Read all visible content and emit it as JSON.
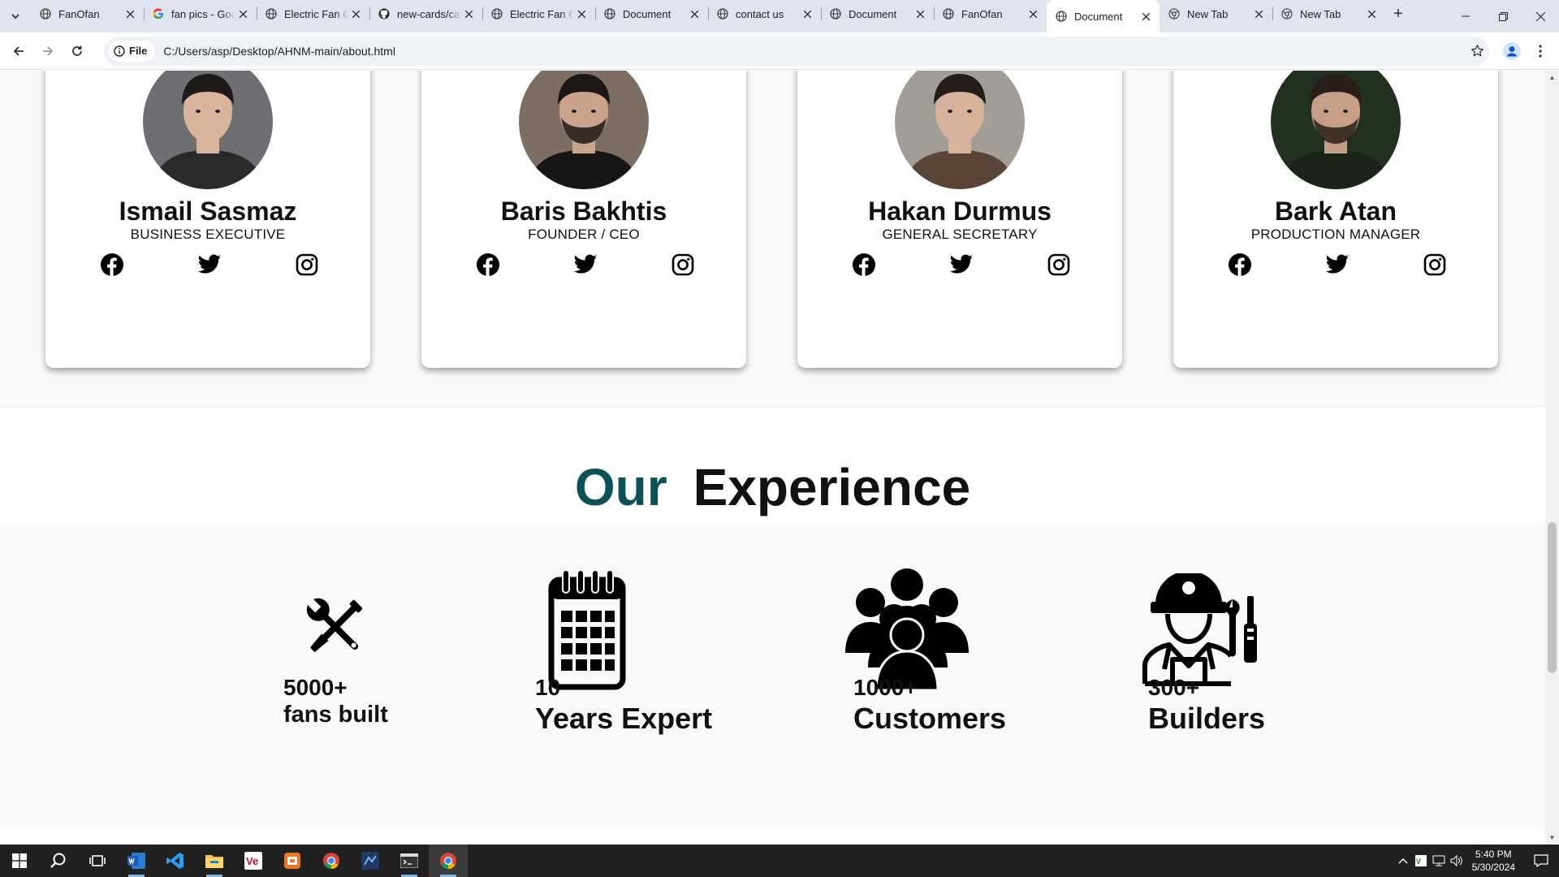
{
  "browser": {
    "tabs": [
      {
        "title": "FanOfan",
        "favicon": "globe-icon"
      },
      {
        "title": "fan pics - Google Search",
        "favicon": "google-icon"
      },
      {
        "title": "Electric Fan Company",
        "favicon": "globe-icon"
      },
      {
        "title": "new-cards/cards",
        "favicon": "github-icon"
      },
      {
        "title": "Electric Fan Company",
        "favicon": "globe-icon"
      },
      {
        "title": "Document",
        "favicon": "globe-icon"
      },
      {
        "title": "contact us",
        "favicon": "globe-icon"
      },
      {
        "title": "Document",
        "favicon": "globe-icon"
      },
      {
        "title": "FanOfan",
        "favicon": "globe-icon"
      },
      {
        "title": "Document",
        "favicon": "globe-icon",
        "active": true
      },
      {
        "title": "New Tab",
        "favicon": "chrome-icon"
      },
      {
        "title": "New Tab",
        "favicon": "chrome-icon"
      }
    ],
    "site_chip": "File",
    "url": "C:/Users/asp/Desktop/AHNM-main/about.html"
  },
  "team": {
    "members": [
      {
        "name": "Ismail Sasmaz",
        "role": "BUSINESS EXECUTIVE"
      },
      {
        "name": "Baris Bakhtis",
        "role": "FOUNDER / CEO"
      },
      {
        "name": "Hakan Durmus",
        "role": "GENERAL SECRETARY"
      },
      {
        "name": "Bark Atan",
        "role": "PRODUCTION MANAGER"
      }
    ],
    "social_icons": [
      "facebook-icon",
      "twitter-icon",
      "instagram-icon"
    ]
  },
  "experience": {
    "title_accent": "Our",
    "title_rest": "Experience",
    "accent_color": "#0b5158",
    "stats": [
      {
        "number": "5000+",
        "label": "fans built",
        "icon": "tools-icon"
      },
      {
        "number": "10",
        "label": "Years Expert",
        "icon": "calendar-icon"
      },
      {
        "number": "1000+",
        "label": "Customers",
        "icon": "users-icon"
      },
      {
        "number": "300+",
        "label": "Builders",
        "icon": "worker-icon"
      }
    ]
  },
  "taskbar": {
    "apps": [
      "start-icon",
      "search-icon",
      "task-view-icon",
      "word-icon",
      "vscode-icon",
      "file-explorer-icon",
      "app-ve-icon",
      "app-orange-icon",
      "chrome-icon",
      "app-blue-icon",
      "terminal-icon",
      "chrome-active-icon"
    ],
    "time": "5:40 PM",
    "date": "5/30/2024"
  }
}
